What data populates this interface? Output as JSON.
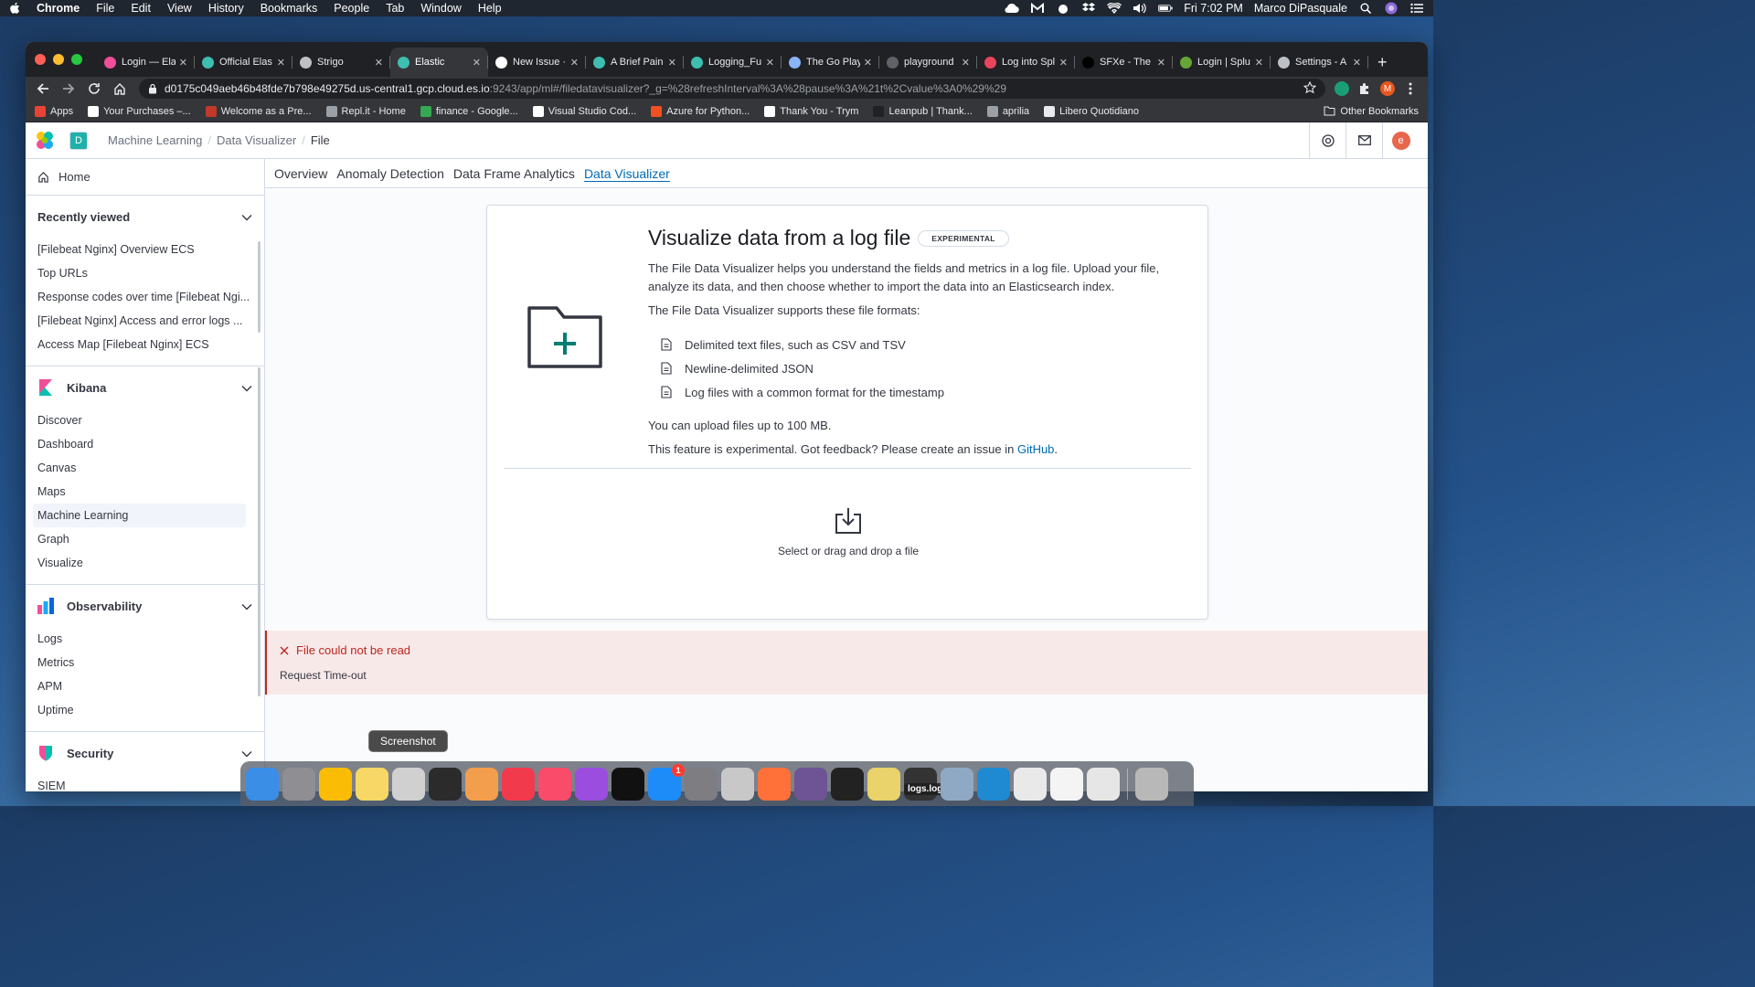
{
  "menubar": {
    "app": "Chrome",
    "items": [
      "File",
      "Edit",
      "View",
      "History",
      "Bookmarks",
      "People",
      "Tab",
      "Window",
      "Help"
    ],
    "clock": "Fri 7:02 PM",
    "user": "Marco DiPasquale"
  },
  "browser": {
    "tabs": [
      {
        "label": "Login — Ela",
        "color": "#f04e98"
      },
      {
        "label": "Official Elas",
        "color": "#3ebeb0"
      },
      {
        "label": "Strigo",
        "color": "#bdc1c6"
      },
      {
        "label": "Elastic",
        "color": "#3ebeb0"
      },
      {
        "label": "New Issue ·",
        "color": "#ffffff"
      },
      {
        "label": "A Brief Pain",
        "color": "#3ebeb0"
      },
      {
        "label": "Logging_Fu",
        "color": "#3ebeb0"
      },
      {
        "label": "The Go Play",
        "color": "#8ab4f8"
      },
      {
        "label": "playground",
        "color": "#5f6368"
      },
      {
        "label": "Log into Spl",
        "color": "#e8445a"
      },
      {
        "label": "SFXe - The",
        "color": "#000000"
      },
      {
        "label": "Login | Splu",
        "color": "#65a637"
      },
      {
        "label": "Settings - A",
        "color": "#bdc1c6"
      }
    ],
    "active_tab_index": 3,
    "url_host": "d0175c049aeb46b48fde7b798e49275d.us-central1.gcp.cloud.es.io",
    "url_path": ":9243/app/ml#/filedatavisualizer?_g=%28refreshInterval%3A%28pause%3A%21t%2Cvalue%3A0%29%29",
    "bookmarks": [
      {
        "label": "Apps",
        "color": "#ea4335"
      },
      {
        "label": "Your Purchases –...",
        "color": "#ffffff"
      },
      {
        "label": "Welcome as a Pre...",
        "color": "#c0392b"
      },
      {
        "label": "Repl.it - Home",
        "color": "#9aa0a6"
      },
      {
        "label": "finance - Google...",
        "color": "#34a853"
      },
      {
        "label": "Visual Studio Cod...",
        "color": "#ffffff"
      },
      {
        "label": "Azure for Python...",
        "color": "#f25022"
      },
      {
        "label": "Thank You - Trym",
        "color": "#ffffff"
      },
      {
        "label": "Leanpub | Thank...",
        "color": "#202124"
      },
      {
        "label": "aprilia",
        "color": "#9aa0a6"
      },
      {
        "label": "Libero Quotidiano",
        "color": "#e8eaed"
      }
    ],
    "other_bookmarks": "Other Bookmarks"
  },
  "kibana": {
    "space_initial": "D",
    "breadcrumbs": [
      "Machine Learning",
      "Data Visualizer",
      "File"
    ],
    "user_initial": "e",
    "nav": {
      "home": "Home",
      "recently_viewed_title": "Recently viewed",
      "recently_viewed": [
        "[Filebeat Nginx] Overview ECS",
        "Top URLs",
        "Response codes over time [Filebeat Ngi...",
        "[Filebeat Nginx] Access and error logs ...",
        "Access Map [Filebeat Nginx] ECS"
      ],
      "kibana_title": "Kibana",
      "kibana_items": [
        "Discover",
        "Dashboard",
        "Canvas",
        "Maps",
        "Machine Learning",
        "Graph",
        "Visualize"
      ],
      "observability_title": "Observability",
      "observability_items": [
        "Logs",
        "Metrics",
        "APM",
        "Uptime"
      ],
      "security_title": "Security",
      "security_items": [
        "SIEM"
      ]
    },
    "subtabs": [
      "Overview",
      "Anomaly Detection",
      "Data Frame Analytics",
      "Data Visualizer"
    ],
    "active_subtab": "Data Visualizer",
    "panel": {
      "title": "Visualize data from a log file",
      "badge": "EXPERIMENTAL",
      "intro": "The File Data Visualizer helps you understand the fields and metrics in a log file. Upload your file, analyze its data, and then choose whether to import the data into an Elasticsearch index.",
      "supports": "The File Data Visualizer supports these file formats:",
      "formats": [
        "Delimited text files, such as CSV and TSV",
        "Newline-delimited JSON",
        "Log files with a common format for the timestamp"
      ],
      "limit": "You can upload files up to 100 MB.",
      "feedback_prefix": "This feature is experimental. Got feedback? Please create an issue in ",
      "feedback_link": "GitHub",
      "feedback_suffix": ".",
      "dropzone_label": "Select or drag and drop a file"
    },
    "error": {
      "title": "File could not be read",
      "body": "Request Time-out"
    }
  },
  "dock": {
    "tooltip": "Screenshot",
    "logs_label": "logs.log",
    "appstore_badge": "1",
    "apps": [
      {
        "name": "Finder",
        "color": "#3a8ee6"
      },
      {
        "name": "Launchpad",
        "color": "#8e8e93"
      },
      {
        "name": "Chrome",
        "color": "#fbbc05"
      },
      {
        "name": "Notes",
        "color": "#f7d766"
      },
      {
        "name": "Screenshot",
        "color": "#d0d0d0"
      },
      {
        "name": "Photo Booth",
        "color": "#2b2b2b"
      },
      {
        "name": "Photos",
        "color": "#f29e4c"
      },
      {
        "name": "News",
        "color": "#f23a4d"
      },
      {
        "name": "Music",
        "color": "#fa4c6a"
      },
      {
        "name": "Podcasts",
        "color": "#9b4ddf"
      },
      {
        "name": "TV",
        "color": "#111111"
      },
      {
        "name": "App Store",
        "color": "#1d8cf8"
      },
      {
        "name": "System Preferences",
        "color": "#7d7d82"
      },
      {
        "name": "Script Editor",
        "color": "#c8c8c8"
      },
      {
        "name": "Firefox",
        "color": "#ff7139"
      },
      {
        "name": "GitHub Desktop",
        "color": "#6e5494"
      },
      {
        "name": "Terminal",
        "color": "#222222"
      },
      {
        "name": "Python Launcher",
        "color": "#e9d36a"
      },
      {
        "name": "Console",
        "color": "#333333"
      },
      {
        "name": "Preview",
        "color": "#8fa9c4"
      },
      {
        "name": "VS Code",
        "color": "#1f8ad2"
      },
      {
        "name": "Numbers",
        "color": "#e9e9e9"
      },
      {
        "name": "TextEdit",
        "color": "#f4f4f4"
      },
      {
        "name": "Downloads",
        "color": "#e6e6e6"
      },
      {
        "name": "Trash",
        "color": "#b8b8b8"
      }
    ]
  }
}
